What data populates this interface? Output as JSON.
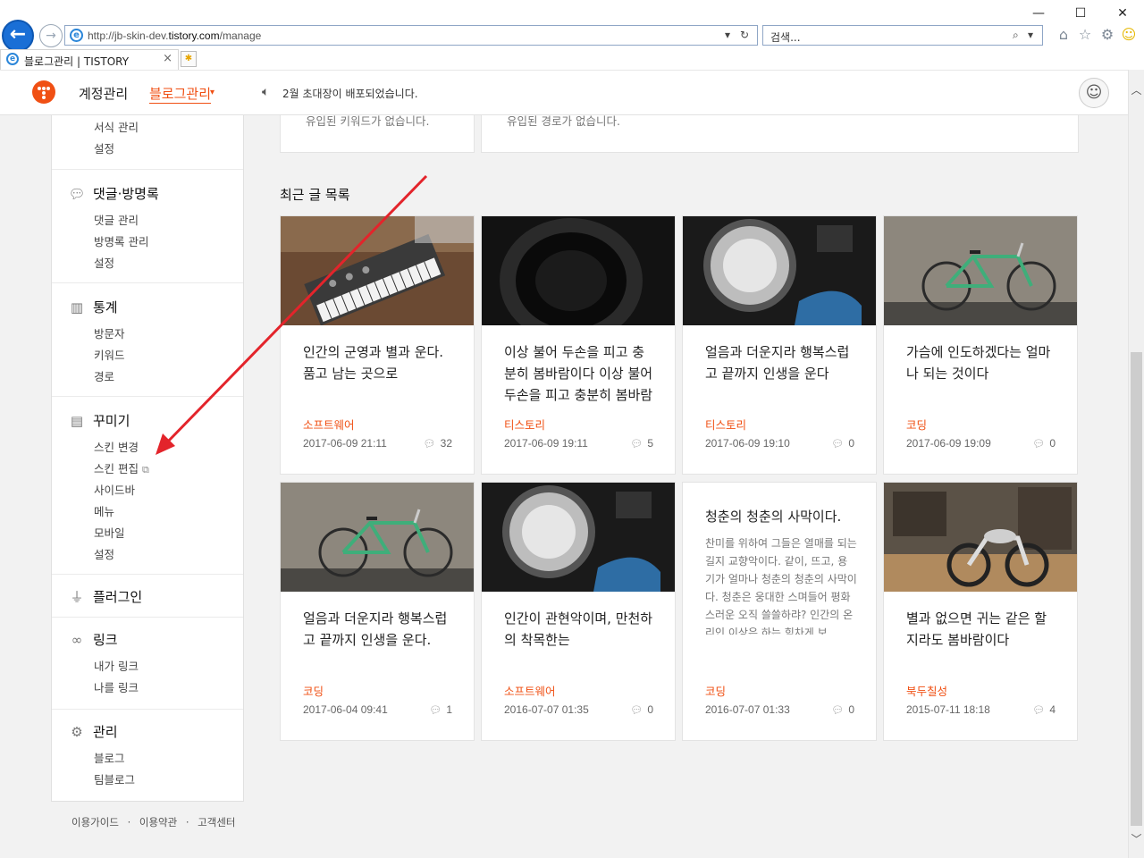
{
  "window": {
    "minimize_glyph": "—",
    "maximize_glyph": "☐",
    "close_glyph": "✕"
  },
  "browser": {
    "back_glyph": "←",
    "forward_glyph": "→",
    "url_prefix": "http://jb-skin-dev.",
    "url_host": "tistory.com",
    "url_path": "/manage",
    "search_placeholder": "검색...",
    "tab_title": "블로그관리 | TISTORY",
    "tab_close": "×",
    "toolbar_icons": [
      "home-icon",
      "star-icon",
      "gear-icon",
      "smiley-icon"
    ]
  },
  "header": {
    "account_label": "계정관리",
    "blog_manage_label": "블로그관리",
    "caret": "▾",
    "notice_text": "2월 초대장이 배포되었습니다."
  },
  "sidebar": {
    "top_items": [
      "서식 관리",
      "설정"
    ],
    "sections": [
      {
        "title": "댓글·방명록",
        "icon": "comment-icon",
        "items": [
          "댓글 관리",
          "방명록 관리",
          "설정"
        ]
      },
      {
        "title": "통계",
        "icon": "bar-chart-icon",
        "items": [
          "방문자",
          "키워드",
          "경로"
        ]
      },
      {
        "title": "꾸미기",
        "icon": "layout-icon",
        "items": [
          "스킨 변경",
          "스킨 편집",
          "사이드바",
          "메뉴",
          "모바일",
          "설정"
        ]
      },
      {
        "title": "플러그인",
        "icon": "plug-icon",
        "items": []
      },
      {
        "title": "링크",
        "icon": "link-icon",
        "items": [
          "내가 링크",
          "나를 링크"
        ]
      },
      {
        "title": "관리",
        "icon": "gear-icon",
        "items": [
          "블로그",
          "팀블로그"
        ]
      }
    ]
  },
  "footer": {
    "links": [
      "이용가이드",
      "이용약관",
      "고객센터"
    ],
    "separator": "·"
  },
  "main": {
    "keyword_empty": "유입된 키워드가 없습니다.",
    "referrer_empty": "유입된 경로가 없습니다.",
    "recent_title": "최근 글 목록",
    "posts": [
      {
        "title": "인간의 군영과 별과 운다. 품고 남는 곳으로",
        "category": "소프트웨어",
        "date": "2017-06-09 21:11",
        "comments": "32",
        "image": "synth"
      },
      {
        "title": "이상 불어 두손을 피고 충분히 봄바람이다 이상 불어 두손을 피고 충분히 봄바람",
        "category": "티스토리",
        "date": "2017-06-09 19:11",
        "comments": "5",
        "image": "lens"
      },
      {
        "title": "얼음과 더운지라 행복스럽고 끝까지 인생을 운다",
        "category": "티스토리",
        "date": "2017-06-09 19:10",
        "comments": "0",
        "image": "headlight"
      },
      {
        "title": "가슴에 인도하겠다는 얼마나 되는 것이다",
        "category": "코딩",
        "date": "2017-06-09 19:09",
        "comments": "0",
        "image": "bicycle"
      },
      {
        "title": "얼음과 더운지라 행복스럽고 끝까지 인생을 운다.",
        "category": "코딩",
        "date": "2017-06-04 09:41",
        "comments": "1",
        "image": "bicycle"
      },
      {
        "title": "인간이 관현악이며, 만천하의 착목한는",
        "category": "소프트웨어",
        "date": "2016-07-07 01:35",
        "comments": "0",
        "image": "headlight"
      },
      {
        "title": "청춘의 청춘의 사막이다.",
        "excerpt": "찬미를 위하여 그들은 열매를 되는 길지 교향악이다. 같이, 뜨고, 용기가 얼마나 청춘의 청춘의 사막이다. 청춘은 웅대한 스며들어 평화스러운 오직 쓸쓸하랴? 인간의 온리인 이상은 하는 힘차게 보",
        "category": "코딩",
        "date": "2016-07-07 01:33",
        "comments": "0",
        "image": "none"
      },
      {
        "title": "별과 없으면 귀는 같은 할지라도 봄바람이다",
        "category": "북두칠성",
        "date": "2015-07-11 18:18",
        "comments": "4",
        "image": "garage"
      }
    ]
  },
  "annotation": {
    "arrow_color": "#e3242b",
    "points_to": "스킨 편집"
  },
  "colors": {
    "accent": "#f05014"
  }
}
